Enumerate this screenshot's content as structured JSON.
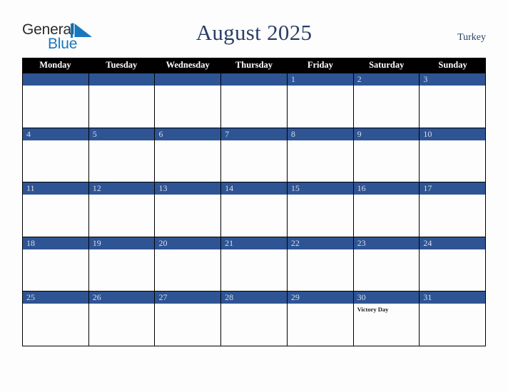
{
  "brand": {
    "name_part1": "General",
    "name_part2": "Blue",
    "mark": "triangle-logo-mark",
    "color_dark": "#2b2b2b",
    "color_blue": "#1878be"
  },
  "header": {
    "title": "August 2025",
    "country": "Turkey",
    "title_color": "#2b3f66"
  },
  "calendar": {
    "weekdays": [
      "Monday",
      "Tuesday",
      "Wednesday",
      "Thursday",
      "Friday",
      "Saturday",
      "Sunday"
    ],
    "header_bg": "#000000",
    "header_text_color": "#ffffff",
    "date_bar_color": "#2e5494",
    "date_text_color": "#d8dde8",
    "cell_bg": "#fdfdfd",
    "weeks": [
      [
        {
          "date": "",
          "events": []
        },
        {
          "date": "",
          "events": []
        },
        {
          "date": "",
          "events": []
        },
        {
          "date": "",
          "events": []
        },
        {
          "date": "1",
          "events": []
        },
        {
          "date": "2",
          "events": []
        },
        {
          "date": "3",
          "events": []
        }
      ],
      [
        {
          "date": "4",
          "events": []
        },
        {
          "date": "5",
          "events": []
        },
        {
          "date": "6",
          "events": []
        },
        {
          "date": "7",
          "events": []
        },
        {
          "date": "8",
          "events": []
        },
        {
          "date": "9",
          "events": []
        },
        {
          "date": "10",
          "events": []
        }
      ],
      [
        {
          "date": "11",
          "events": []
        },
        {
          "date": "12",
          "events": []
        },
        {
          "date": "13",
          "events": []
        },
        {
          "date": "14",
          "events": []
        },
        {
          "date": "15",
          "events": []
        },
        {
          "date": "16",
          "events": []
        },
        {
          "date": "17",
          "events": []
        }
      ],
      [
        {
          "date": "18",
          "events": []
        },
        {
          "date": "19",
          "events": []
        },
        {
          "date": "20",
          "events": []
        },
        {
          "date": "21",
          "events": []
        },
        {
          "date": "22",
          "events": []
        },
        {
          "date": "23",
          "events": []
        },
        {
          "date": "24",
          "events": []
        }
      ],
      [
        {
          "date": "25",
          "events": []
        },
        {
          "date": "26",
          "events": []
        },
        {
          "date": "27",
          "events": []
        },
        {
          "date": "28",
          "events": []
        },
        {
          "date": "29",
          "events": []
        },
        {
          "date": "30",
          "events": [
            "Victory Day"
          ]
        },
        {
          "date": "31",
          "events": []
        }
      ]
    ]
  }
}
